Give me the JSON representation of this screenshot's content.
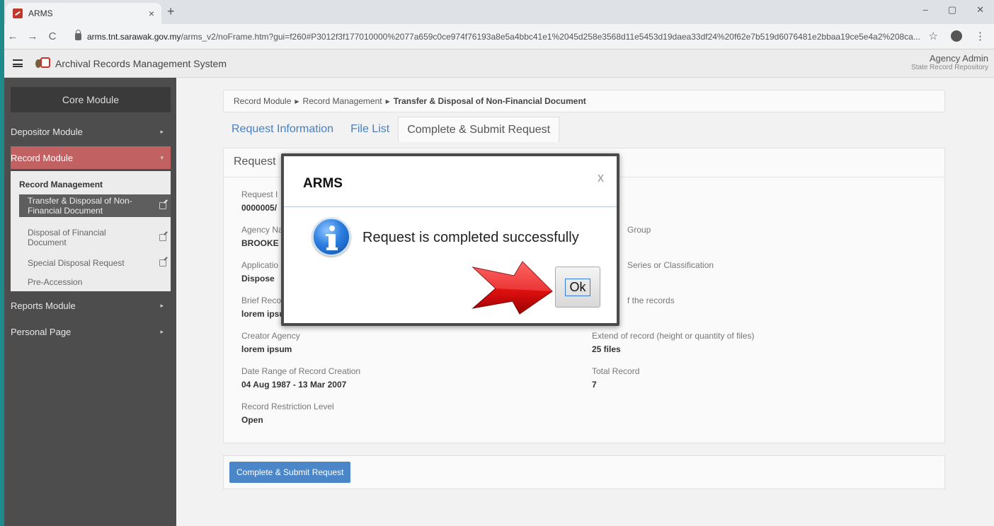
{
  "browser": {
    "tab_title": "ARMS",
    "tab_close": "×",
    "new_tab": "+",
    "win_min": "–",
    "win_max": "▢",
    "win_close": "✕",
    "back": "←",
    "forward": "→",
    "reload": "C",
    "url_host": "arms.tnt.sarawak.gov.my",
    "url_path": "/arms_v2/noFrame.htm?gui=f260#P3012f3f177010000%2077a659c0ce974f76193a8e5a4bbc41e1%2045d258e3568d11e5453d19daea33df24%20f62e7b519d6076481e2bbaa19ce5e4a2%208ca...",
    "star": "☆",
    "menu": "⋮"
  },
  "header": {
    "app_title": "Archival Records Management System",
    "user_name": "Agency Admin",
    "user_role": "State Record Repository"
  },
  "sidebar": {
    "core_module": "Core Module",
    "items": [
      {
        "label": "Depositor Module"
      },
      {
        "label": "Record Module"
      },
      {
        "label": "Reports Module"
      },
      {
        "label": "Personal Page"
      }
    ],
    "submenu_head": "Record Management",
    "sub_items": [
      {
        "label": "Transfer & Disposal of Non-Financial Document"
      },
      {
        "label": "Disposal of Financial Document"
      },
      {
        "label": "Special Disposal Request"
      },
      {
        "label": "Pre-Accession"
      }
    ]
  },
  "main": {
    "breadcrumb": [
      "Record Module",
      "Record Management",
      "Transfer & Disposal of Non-Financial Document"
    ],
    "tabs": [
      "Request Information",
      "File List",
      "Complete & Submit Request"
    ],
    "card_title": "Request",
    "fields_left": [
      {
        "label": "Request I",
        "value": "0000005/"
      },
      {
        "label": "Agency Na",
        "value": "BROOKE H"
      },
      {
        "label": "Applicatio",
        "value": "Dispose"
      },
      {
        "label": "Brief Reco",
        "value": "lorem ipsu"
      },
      {
        "label": "Creator Agency",
        "value": "lorem ipsum"
      },
      {
        "label": "Date Range of Record Creation",
        "value": "04 Aug 1987 - 13 Mar 2007"
      },
      {
        "label": "Record Restriction Level",
        "value": "Open"
      }
    ],
    "fields_right": [
      {
        "label": "Group",
        "value": ""
      },
      {
        "label": "Series or Classification",
        "value": ""
      },
      {
        "label": "f the records",
        "value": ""
      },
      {
        "label": "Extend of record (height or quantity of files)",
        "value": "25 files"
      },
      {
        "label": "Total Record",
        "value": "7"
      }
    ],
    "submit_label": "Complete & Submit Request"
  },
  "modal": {
    "title": "ARMS",
    "close": "x",
    "message": "Request is completed successfully",
    "ok_label": "Ok"
  }
}
